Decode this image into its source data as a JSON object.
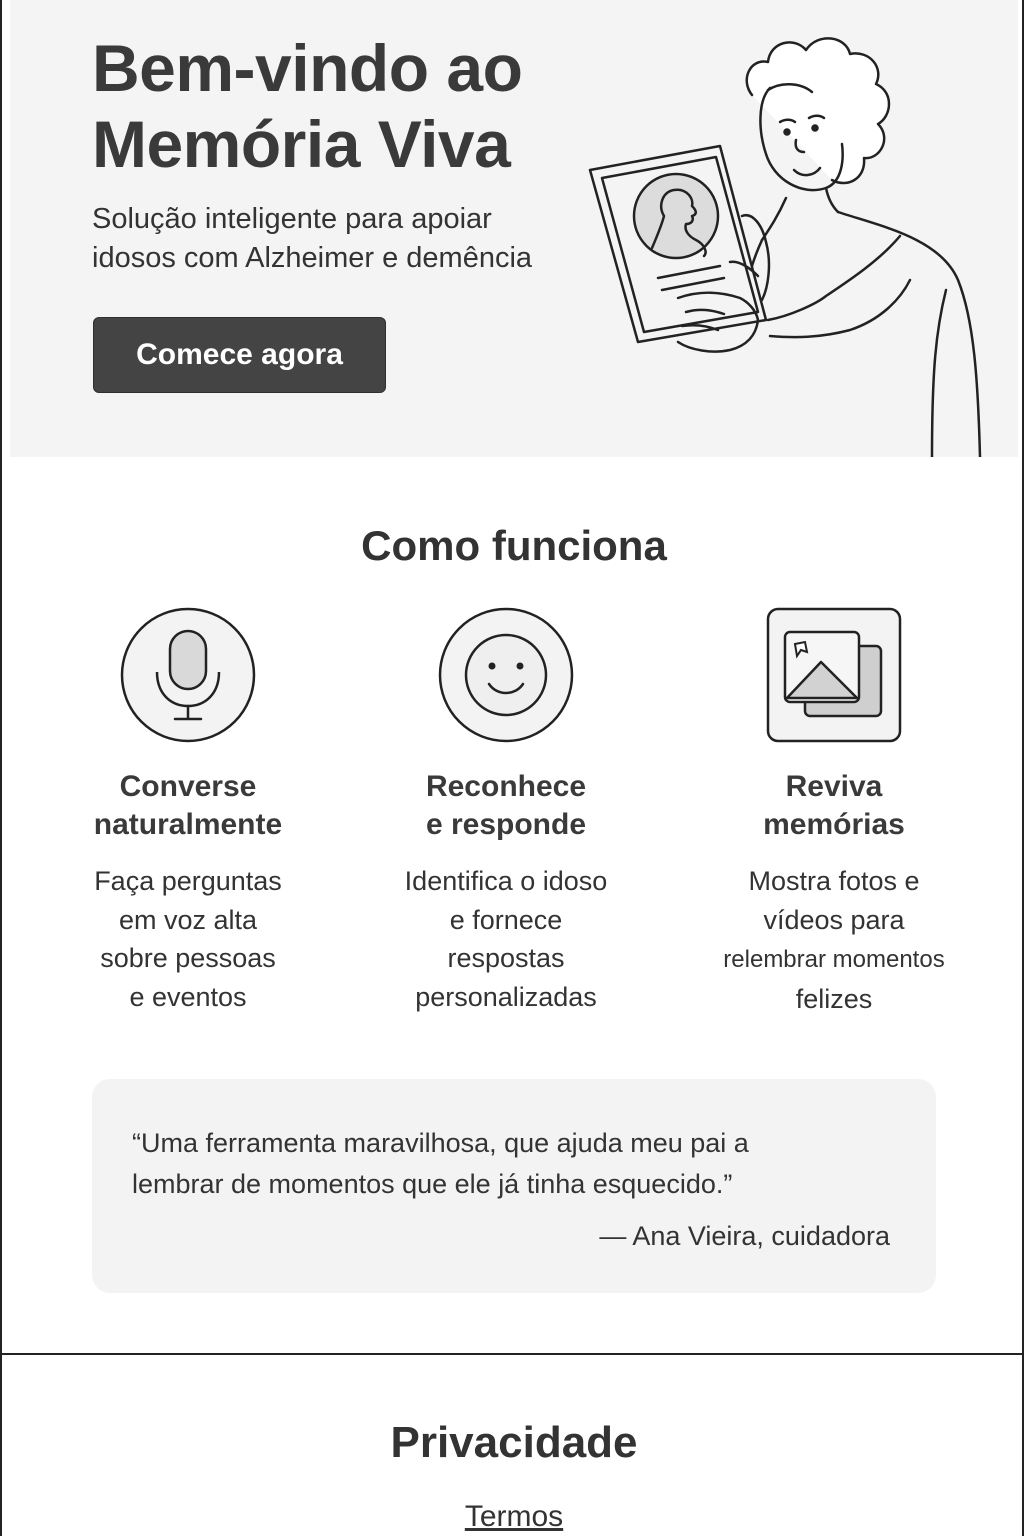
{
  "hero": {
    "title_line1": "Bem-vindo ao",
    "title_line2": "Memória Viva",
    "subtitle_line1": "Solução inteligente para apoiar",
    "subtitle_line2": "idosos com Alzheimer e demência",
    "cta_label": "Comece agora",
    "illustration": "person-holding-photo-frame-illustration"
  },
  "how_it_works": {
    "title": "Como funciona",
    "features": [
      {
        "icon": "microphone-icon",
        "title_line1": "Converse",
        "title_line2": "naturalmente",
        "desc_lines": [
          "Faça perguntas",
          "em voz alta",
          "sobre pessoas",
          "e eventos"
        ]
      },
      {
        "icon": "smile-icon",
        "title_line1": "Reconhece",
        "title_line2": "e responde",
        "desc_lines": [
          "Identifica o idoso",
          "e fornece",
          "respostas",
          "personalizadas"
        ]
      },
      {
        "icon": "photos-icon",
        "title_line1": "Reviva",
        "title_line2": "memórias",
        "desc_lines": [
          "Mostra fotos e",
          "vídeos para",
          "relembrar momentos",
          "felizes"
        ]
      }
    ]
  },
  "testimonial": {
    "quote_line1": "“Uma ferramenta maravilhosa, que ajuda meu pai a",
    "quote_line2": "lembrar de momentos que ele já tinha esquecido.”",
    "author": "— Ana Vieira, cuidadora"
  },
  "footer": {
    "title": "Privacidade",
    "terms_link": "Termos"
  },
  "colors": {
    "hero_bg": "#f4f4f4",
    "button_bg": "#444444",
    "text": "#333333",
    "card_bg": "#f3f3f3"
  }
}
